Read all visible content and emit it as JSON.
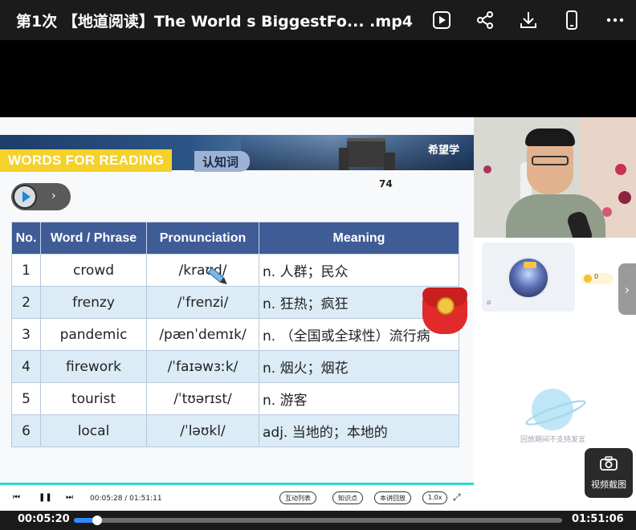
{
  "header": {
    "title": "第1次 【地道阅读】The World s BiggestFo... .mp4",
    "icons": [
      "video-play-icon",
      "share-icon",
      "download-icon",
      "phone-icon",
      "more-icon"
    ]
  },
  "slide": {
    "banner_label": "WORDS FOR READING",
    "banner_tag": "认知词",
    "brand": "希望学",
    "page_number": "74",
    "table": {
      "headers": [
        "No.",
        "Word / Phrase",
        "Pronunciation",
        "Meaning"
      ],
      "rows": [
        {
          "no": "1",
          "word": "crowd",
          "pron": "/kraʊd/",
          "meaning": "n. 人群；民众"
        },
        {
          "no": "2",
          "word": "frenzy",
          "pron": "/ˈfrenzi/",
          "meaning": "n. 狂热；疯狂"
        },
        {
          "no": "3",
          "word": "pandemic",
          "pron": "/pænˈdemɪk/",
          "meaning": "n. （全国或全球性）流行病"
        },
        {
          "no": "4",
          "word": "firework",
          "pron": "/ˈfaɪəwɜːk/",
          "meaning": "n. 烟火；烟花"
        },
        {
          "no": "5",
          "word": "tourist",
          "pron": "/ˈtʊərɪst/",
          "meaning": "n. 游客"
        },
        {
          "no": "6",
          "word": "local",
          "pron": "/ˈləʊkl/",
          "meaning": "adj. 当地的；本地的"
        }
      ]
    }
  },
  "side": {
    "coin_count": "0",
    "no_message": "回放期间不支持发言",
    "snapshot_label": "视频截图"
  },
  "slide_controls": {
    "time": "00:05:28 / 01:51:11",
    "chips": [
      "互动列表",
      "知识点",
      "本讲回放",
      "1.0x"
    ]
  },
  "player": {
    "current_time": "00:05:20",
    "duration": "01:51:06",
    "progress": 0.048
  },
  "colors": {
    "table_header": "#3f5c97",
    "row_alt": "#dbecf7",
    "accent_yellow": "#f4d12b",
    "progress": "#2f8cff"
  }
}
